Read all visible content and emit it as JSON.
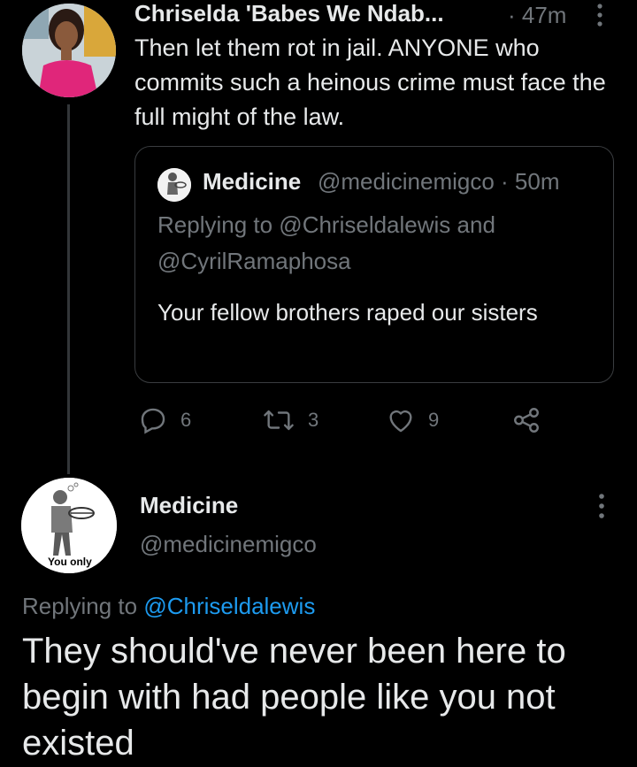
{
  "tweet": {
    "author_name": "Chriselda 'Babes We Ndab...",
    "time": "· 47m",
    "text": "Then let them rot in jail. ANYONE who commits such a heinous crime must face the full might of the law.",
    "quoted": {
      "author_name": "Medicine",
      "handle_time": "@medicinemigco · 50m",
      "replying_line1": "Replying to @Chriseldalewis and",
      "replying_line2": "@CyrilRamaphosa",
      "text": "Your fellow brothers raped our sisters"
    },
    "actions": {
      "replies": "6",
      "retweets": "3",
      "likes": "9"
    }
  },
  "reply": {
    "author_name": "Medicine",
    "handle": "@medicinemigco",
    "avatar_caption": "You only",
    "replying_prefix": "Replying to ",
    "replying_mention": "@Chriseldalewis",
    "text": "They should've never been here to begin with had people like you not existed"
  },
  "colors": {
    "background": "#000000",
    "text": "#e7e9ea",
    "muted": "#71767b",
    "link": "#1d9bf0"
  }
}
